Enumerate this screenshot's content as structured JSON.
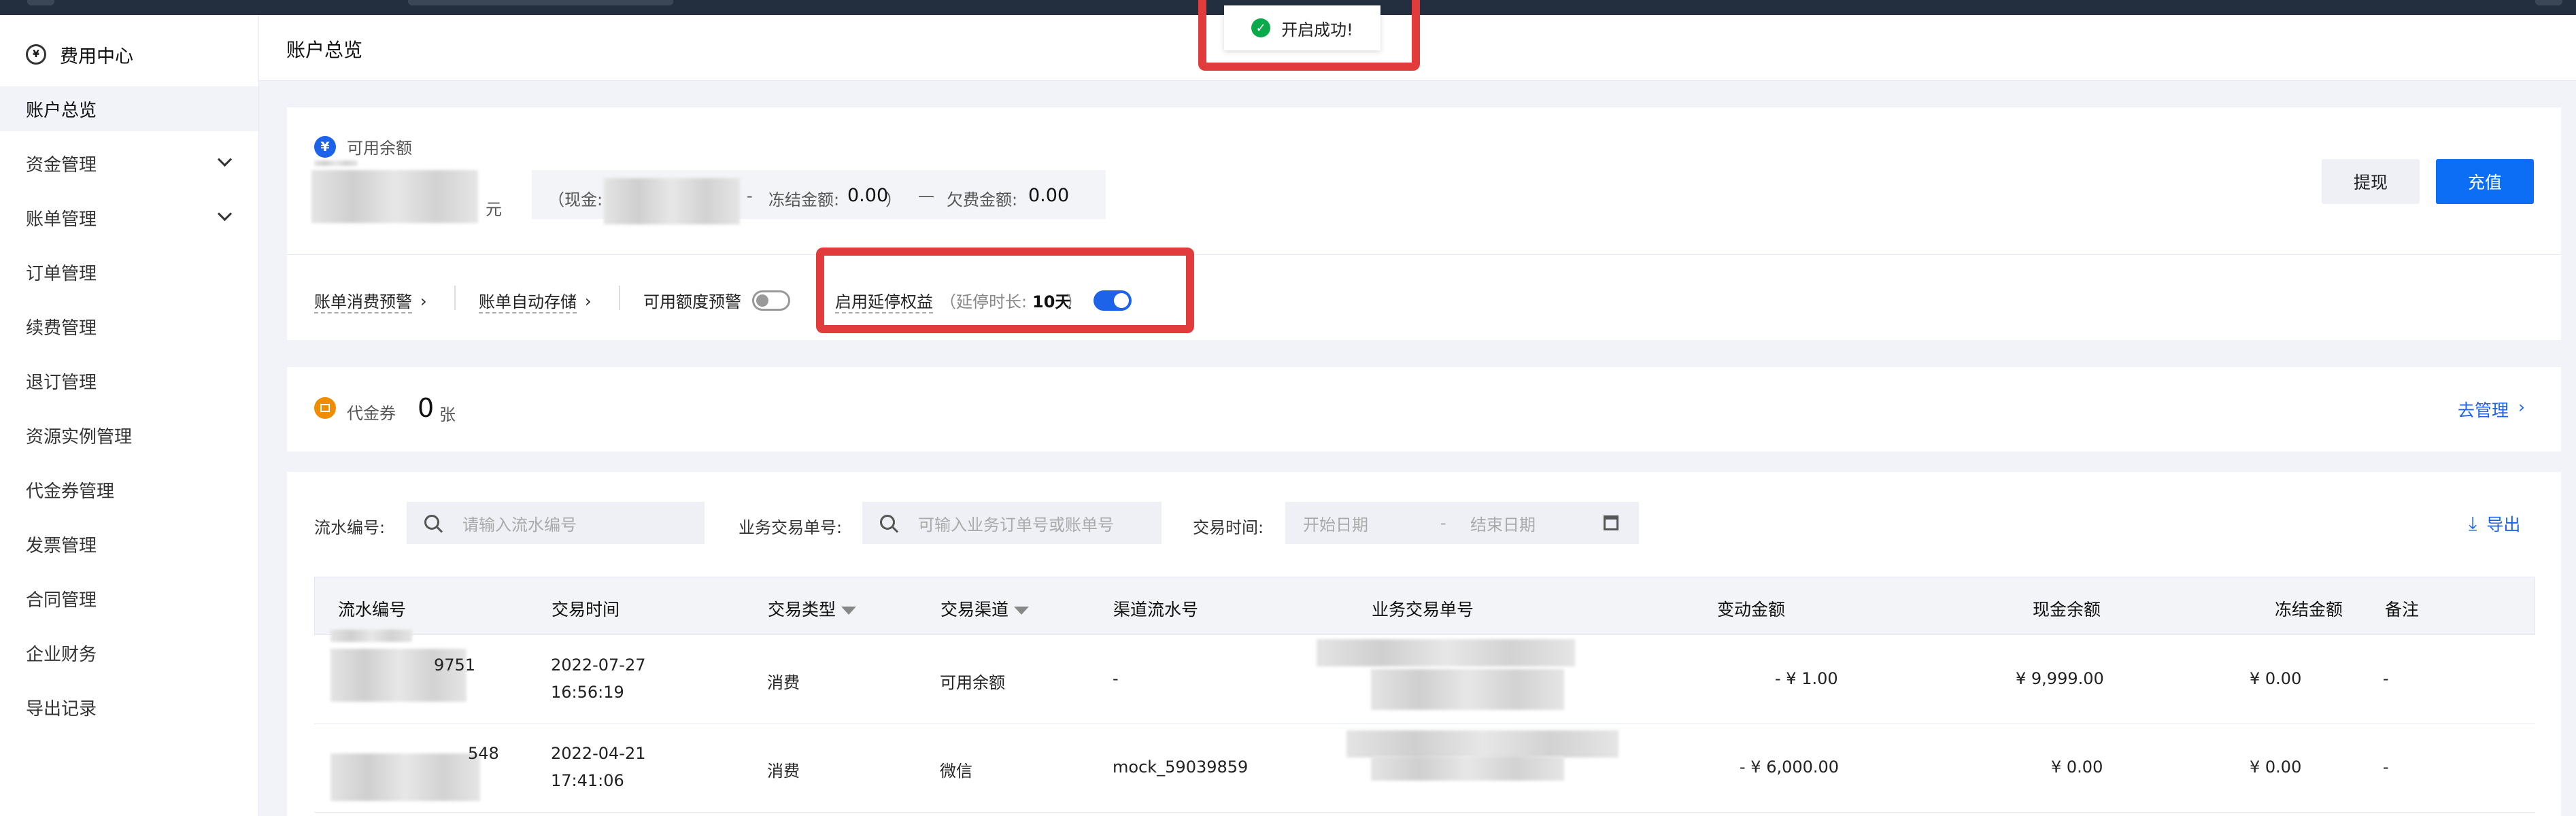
{
  "sidebar": {
    "title": "费用中心",
    "items": [
      {
        "label": "账户总览"
      },
      {
        "label": "资金管理"
      },
      {
        "label": "账单管理"
      },
      {
        "label": "订单管理"
      },
      {
        "label": "续费管理"
      },
      {
        "label": "退订管理"
      },
      {
        "label": "资源实例管理"
      },
      {
        "label": "代金券管理"
      },
      {
        "label": "发票管理"
      },
      {
        "label": "合同管理"
      },
      {
        "label": "企业财务"
      },
      {
        "label": "导出记录"
      }
    ]
  },
  "header": {
    "title": "账户总览"
  },
  "toast": {
    "message": "开启成功!"
  },
  "balance": {
    "icon": "¥",
    "label": "可用余额",
    "unit": "元",
    "cash_prefix": "（现金:",
    "dash1": "-",
    "frozen_label": "冻结金额:",
    "frozen_value": "0.00",
    "close_paren": "）",
    "dash2": "—",
    "debt_label": "欠费金额:",
    "debt_value": "0.00",
    "withdraw": "提现",
    "recharge": "充值"
  },
  "settings": {
    "bill_alert": "账单消费预警",
    "bill_storage": "账单自动存储",
    "quota_alert": "可用额度预警",
    "extension": "启用延停权益",
    "extension_note_prefix": "（延停时长:",
    "extension_days": "10天",
    "extension_note_suffix": "）"
  },
  "voucher": {
    "label": "代金券",
    "count": "0",
    "unit": "张",
    "manage": "去管理"
  },
  "filters": {
    "serial_label": "流水编号:",
    "serial_placeholder": "请输入流水编号",
    "biz_label": "业务交易单号:",
    "biz_placeholder": "可输入业务订单号或账单号",
    "time_label": "交易时间:",
    "start_placeholder": "开始日期",
    "range_dash": "-",
    "end_placeholder": "结束日期",
    "export": "导出"
  },
  "table": {
    "headers": [
      "流水编号",
      "交易时间",
      "交易类型",
      "交易渠道",
      "渠道流水号",
      "业务交易单号",
      "变动金额",
      "现金余额",
      "冻结金额",
      "备注"
    ],
    "rows": [
      {
        "serial_tail": "9751",
        "date": "2022-07-27",
        "time": "16:56:19",
        "type": "消费",
        "channel": "可用余额",
        "channel_serial": "-",
        "amount": "- ¥ 1.00",
        "cash": "¥ 9,999.00",
        "frozen": "¥ 0.00",
        "note": "-"
      },
      {
        "serial_tail": "548",
        "date": "2022-04-21",
        "time": "17:41:06",
        "type": "消费",
        "channel": "微信",
        "channel_serial": "mock_59039859",
        "amount": "- ¥ 6,000.00",
        "cash": "¥ 0.00",
        "frozen": "¥ 0.00",
        "note": "-"
      }
    ]
  },
  "colors": {
    "accent": "#1d63ea",
    "highlight": "#e23b3b",
    "success": "#0aaa4b"
  }
}
